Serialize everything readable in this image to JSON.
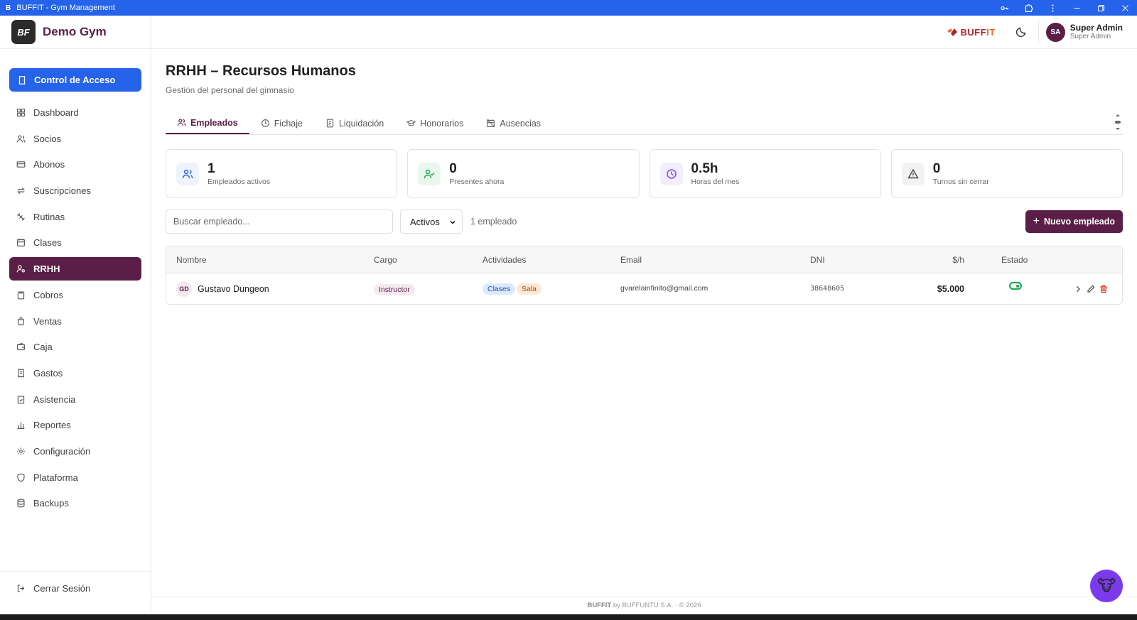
{
  "window": {
    "app_initial": "B",
    "title": "BUFFIT - Gym Management"
  },
  "sidebar": {
    "brand": "Demo Gym",
    "brand_logo": "BF",
    "access_button": "Control de Acceso",
    "items": [
      {
        "label": "Dashboard",
        "icon": "grid-icon"
      },
      {
        "label": "Socios",
        "icon": "users-icon"
      },
      {
        "label": "Abonos",
        "icon": "card-icon"
      },
      {
        "label": "Suscripciones",
        "icon": "repeat-icon"
      },
      {
        "label": "Rutinas",
        "icon": "dumbbell-icon"
      },
      {
        "label": "Clases",
        "icon": "calendar-icon"
      },
      {
        "label": "RRHH",
        "icon": "user-cog-icon",
        "active": true
      },
      {
        "label": "Cobros",
        "icon": "clipboard-icon"
      },
      {
        "label": "Ventas",
        "icon": "bag-icon"
      },
      {
        "label": "Caja",
        "icon": "wallet-icon"
      },
      {
        "label": "Gastos",
        "icon": "receipt-icon"
      },
      {
        "label": "Asistencia",
        "icon": "clipboard-check-icon"
      },
      {
        "label": "Reportes",
        "icon": "bar-chart-icon"
      },
      {
        "label": "Configuración",
        "icon": "gear-icon"
      },
      {
        "label": "Plataforma",
        "icon": "shield-icon"
      },
      {
        "label": "Backups",
        "icon": "database-icon"
      }
    ],
    "logout": "Cerrar Sesión"
  },
  "header": {
    "logo_text_a": "BUFF",
    "logo_text_b": "IT",
    "user_initials": "SA",
    "user_name": "Super Admin",
    "user_role": "Super Admin"
  },
  "page": {
    "title": "RRHH – Recursos Humanos",
    "subtitle": "Gestión del personal del gimnasio"
  },
  "tabs": [
    {
      "label": "Empleados",
      "icon": "users-icon",
      "active": true
    },
    {
      "label": "Fichaje",
      "icon": "clock-icon"
    },
    {
      "label": "Liquidación",
      "icon": "document-icon"
    },
    {
      "label": "Honorarios",
      "icon": "graduation-cap-icon"
    },
    {
      "label": "Ausencias",
      "icon": "calendar-off-icon"
    }
  ],
  "stats": [
    {
      "value": "1",
      "label": "Empleados activos",
      "color": "#2563eb",
      "bg": "#eef3fe"
    },
    {
      "value": "0",
      "label": "Presentes ahora",
      "color": "#16a34a",
      "bg": "#eaf7ee"
    },
    {
      "value": "0.5h",
      "label": "Horas del mes",
      "color": "#7c3aed",
      "bg": "#f3eefd"
    },
    {
      "value": "0",
      "label": "Turnos sin cerrar",
      "color": "#555555",
      "bg": "#f3f3f3"
    }
  ],
  "toolbar": {
    "search_placeholder": "Buscar empleado...",
    "filter_value": "Activos",
    "count": "1 empleado",
    "new_button": "Nuevo empleado"
  },
  "table": {
    "headers": [
      "Nombre",
      "Cargo",
      "Actividades",
      "Email",
      "DNI",
      "$/h",
      "Estado"
    ],
    "rows": [
      {
        "initials": "GD",
        "name": "Gustavo Dungeon",
        "cargo": "Instructor",
        "activities": [
          "Clases",
          "Sala"
        ],
        "email": "gvarelainfinito@gmail.com",
        "dni": "38648605",
        "rate": "$5.000",
        "active": true
      }
    ]
  },
  "footer": {
    "brand": "BUFFIT",
    "text": " by BUFFUNTU S.A. · © 2026"
  },
  "colors": {
    "primary": "#2563eb",
    "brand": "#5b1f47"
  }
}
